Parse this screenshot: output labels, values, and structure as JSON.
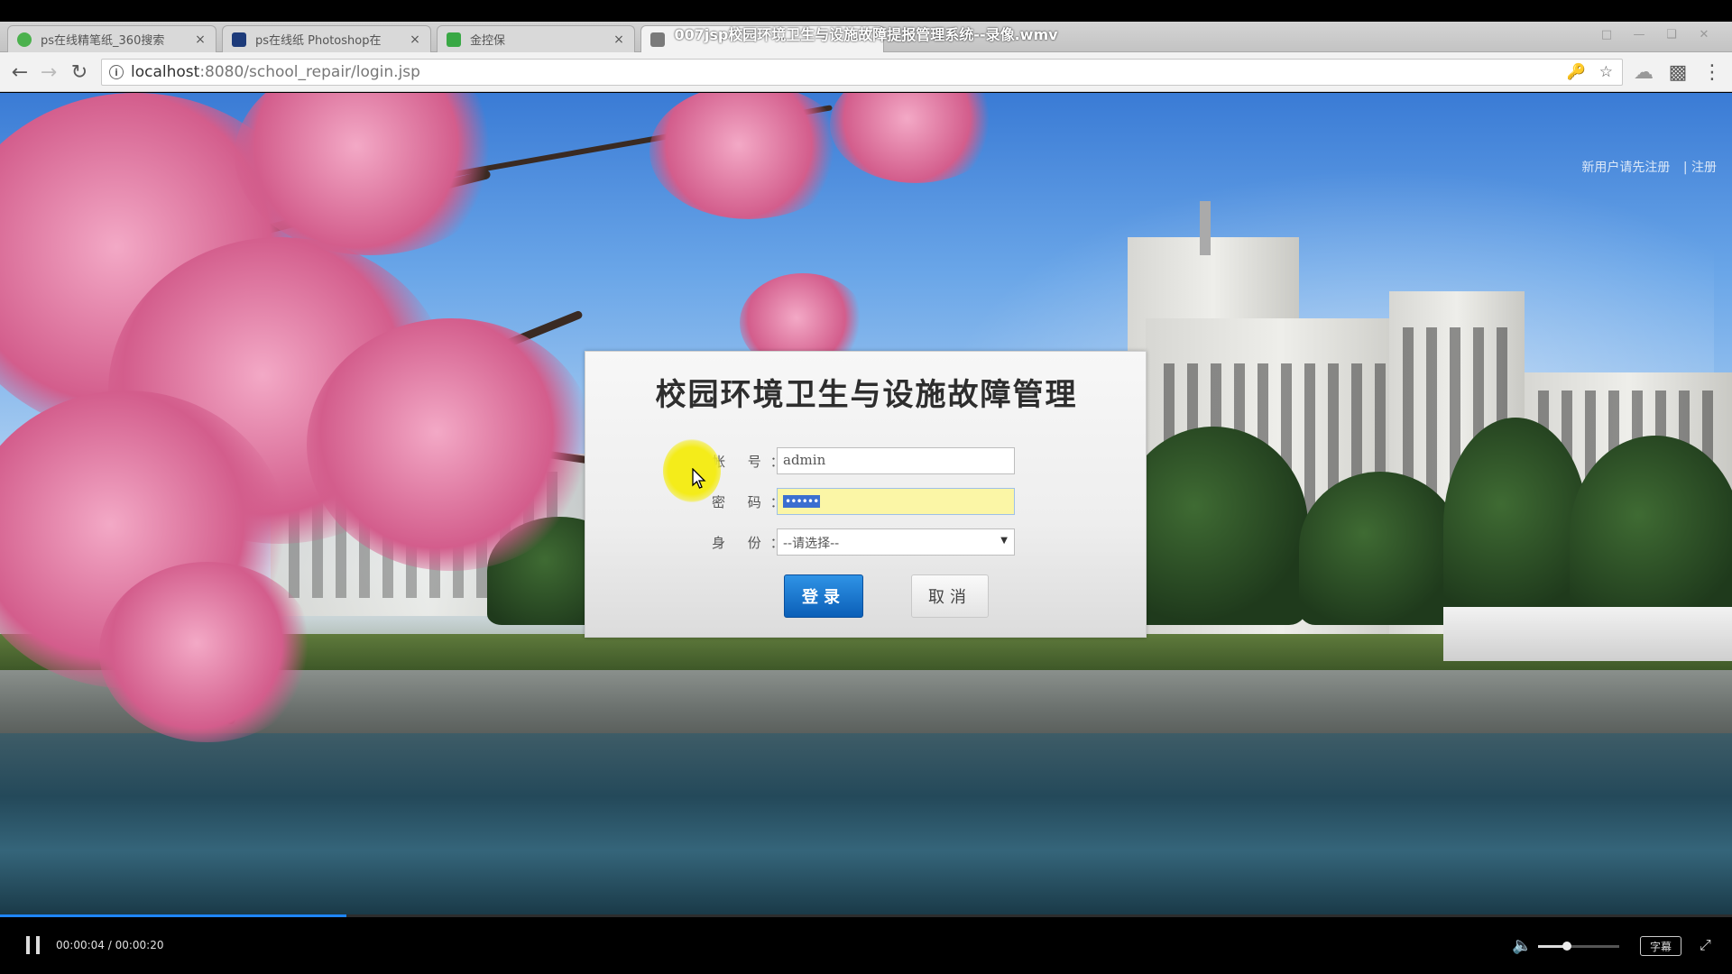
{
  "player": {
    "title": "007jsp校园环境卫生与设施故障提报管理系统--录像.wmv",
    "time": "00:00:04 / 00:00:20",
    "progress_fraction": 0.2,
    "volume_fraction": 0.35,
    "subtitle_label": "字幕"
  },
  "browser": {
    "tabs": [
      {
        "label": "ps在线精笔纸_360搜索",
        "close": "×",
        "favicon_color": "#4bb14d"
      },
      {
        "label": "ps在线纸 Photoshop在",
        "close": "×",
        "favicon_color": "#1d3b7a"
      },
      {
        "label": "金控保",
        "close": "×",
        "favicon_color": "#39a845"
      },
      {
        "label": "",
        "close": "",
        "favicon_color": "#7a7a7a"
      }
    ],
    "url_host": "localhost",
    "url_path": ":8080/school_repair/login.jsp"
  },
  "page": {
    "register_text": "新用户请先注册",
    "register_link": "| 注册",
    "login": {
      "title": "校园环境卫生与设施故障管理",
      "account_label": "帐  号：",
      "account_value": "admin",
      "password_label": "密  码：",
      "password_value": "••••••",
      "role_label": "身  份：",
      "role_selected": "--请选择--",
      "login_button": "登录",
      "cancel_button": "取消"
    }
  },
  "colors": {
    "accent": "#1f86ff",
    "login_button": "#0b5fb8",
    "focus_field": "#fbf6a6",
    "cursor_halo": "#f4ec1a"
  }
}
